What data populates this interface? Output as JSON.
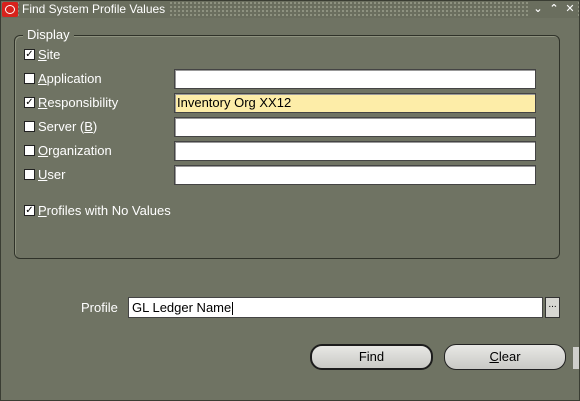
{
  "window": {
    "title": "Find System Profile Values",
    "controls": [
      "⌄",
      "⌃",
      "✕"
    ]
  },
  "display": {
    "legend": "Display",
    "site": {
      "label_u": "S",
      "label_rest": "ite",
      "checked": true
    },
    "application": {
      "label_u": "A",
      "label_rest": "pplication",
      "checked": false,
      "value": ""
    },
    "responsibility": {
      "label_u": "R",
      "label_rest": "esponsibility",
      "checked": true,
      "value": "Inventory Org XX12"
    },
    "server": {
      "label_pre": "Server (",
      "label_u": "B",
      "label_post": ")",
      "checked": false,
      "value": ""
    },
    "organization": {
      "label_u": "O",
      "label_rest": "rganization",
      "checked": false,
      "value": ""
    },
    "user": {
      "label_u": "U",
      "label_rest": "ser",
      "checked": false,
      "value": ""
    },
    "no_values": {
      "label_u": "P",
      "label_rest": "rofiles with No Values",
      "checked": true
    }
  },
  "profile": {
    "label": "Profile",
    "value": "GL Ledger Name",
    "lov_label": "..."
  },
  "buttons": {
    "find": "Find",
    "clear_u": "C",
    "clear_rest": "lear"
  },
  "colors": {
    "background": "#6f7363",
    "active_field": "#fdeda8"
  }
}
